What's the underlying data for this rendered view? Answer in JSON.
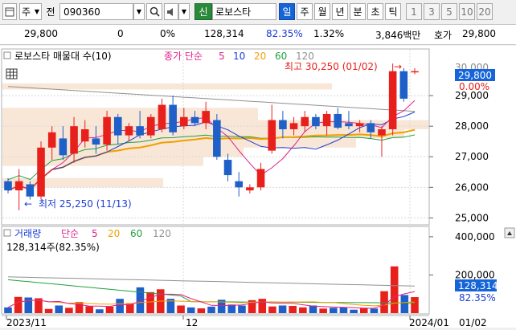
{
  "toolbar": {
    "market": "주",
    "market_prefix": "전",
    "code": "090360",
    "credit_tag": "신",
    "stock_name": "로보스타",
    "periods": [
      "일",
      "주",
      "월",
      "년",
      "분",
      "초",
      "틱"
    ],
    "active_period": "일",
    "intervals": [
      "1",
      "3",
      "5",
      "10",
      "20"
    ]
  },
  "infobar": {
    "price": "29,800",
    "change": "0",
    "change_pct": "0%",
    "volume": "128,314",
    "volume_ratio": "82.35%",
    "turnover": "1.32%",
    "amount": "3,846백만",
    "quote_label": "호가",
    "quote_price": "29,800"
  },
  "price_panel": {
    "title": "로보스타 매물대 수(10)",
    "ma_label": "종가 단순",
    "ma_periods": [
      "5",
      "10",
      "20",
      "60",
      "120"
    ],
    "high_label": "최고 30,250 (01/02)",
    "low_label": "최저 25,250 (11/13)",
    "price_tag": "29,800",
    "pct_tag": "0.00%",
    "y_ticks": [
      "29,000",
      "28,000",
      "27,000",
      "26,000",
      "25,000"
    ],
    "y_top_partial": "30,000"
  },
  "volume_panel": {
    "title": "거래량",
    "ma_label": "단순",
    "ma_periods": [
      "5",
      "20",
      "60",
      "120"
    ],
    "value_label": "128,314주(82.35%)",
    "vol_tag": "128,314",
    "vol_pct_tag": "82.35%",
    "y_ticks": [
      "400,000",
      "200,000"
    ]
  },
  "x_axis": {
    "labels": [
      "2023/11",
      "12",
      "2024/01",
      "01/02"
    ]
  },
  "colors": {
    "up": "#e8201c",
    "down": "#1e5fc8",
    "ma5": "#e0208c",
    "ma10": "#1a3dd6",
    "ma20": "#f0a000",
    "ma60": "#20a040",
    "ma120": "#909090",
    "profile": "#f5dcc4",
    "tag": "#1565d8"
  },
  "chart_data": {
    "type": "candlestick",
    "candles": [
      {
        "o": 26200,
        "h": 26300,
        "l": 25800,
        "c": 25900
      },
      {
        "o": 25900,
        "h": 26600,
        "l": 25250,
        "c": 26200
      },
      {
        "o": 26100,
        "h": 26200,
        "l": 25600,
        "c": 25700
      },
      {
        "o": 25700,
        "h": 27500,
        "l": 25600,
        "c": 27300
      },
      {
        "o": 27300,
        "h": 28000,
        "l": 26900,
        "c": 27800
      },
      {
        "o": 27600,
        "h": 28000,
        "l": 26900,
        "c": 27050
      },
      {
        "o": 27100,
        "h": 28300,
        "l": 26800,
        "c": 28000
      },
      {
        "o": 27500,
        "h": 28200,
        "l": 27300,
        "c": 27900
      },
      {
        "o": 27600,
        "h": 28000,
        "l": 27100,
        "c": 27400
      },
      {
        "o": 27400,
        "h": 28500,
        "l": 27200,
        "c": 28300
      },
      {
        "o": 28300,
        "h": 28400,
        "l": 27400,
        "c": 27700
      },
      {
        "o": 27700,
        "h": 28100,
        "l": 27500,
        "c": 28000
      },
      {
        "o": 28000,
        "h": 28500,
        "l": 27600,
        "c": 27700
      },
      {
        "o": 27700,
        "h": 28400,
        "l": 27600,
        "c": 28300
      },
      {
        "o": 27900,
        "h": 28900,
        "l": 27800,
        "c": 28700
      },
      {
        "o": 28700,
        "h": 29000,
        "l": 27700,
        "c": 27800
      },
      {
        "o": 28000,
        "h": 28600,
        "l": 27900,
        "c": 28300
      },
      {
        "o": 28300,
        "h": 28500,
        "l": 28000,
        "c": 28100
      },
      {
        "o": 28100,
        "h": 28800,
        "l": 27900,
        "c": 28500
      },
      {
        "o": 28200,
        "h": 28400,
        "l": 26900,
        "c": 27000
      },
      {
        "o": 26900,
        "h": 27100,
        "l": 26200,
        "c": 26400
      },
      {
        "o": 26200,
        "h": 26500,
        "l": 25700,
        "c": 26000
      },
      {
        "o": 25900,
        "h": 26100,
        "l": 25800,
        "c": 26000
      },
      {
        "o": 26000,
        "h": 26800,
        "l": 25900,
        "c": 26600
      },
      {
        "o": 27200,
        "h": 28700,
        "l": 27100,
        "c": 28200
      },
      {
        "o": 28200,
        "h": 28500,
        "l": 27600,
        "c": 27900
      },
      {
        "o": 27900,
        "h": 28300,
        "l": 27700,
        "c": 28100
      },
      {
        "o": 28000,
        "h": 28500,
        "l": 27800,
        "c": 28300
      },
      {
        "o": 28300,
        "h": 28400,
        "l": 27900,
        "c": 28000
      },
      {
        "o": 28000,
        "h": 28500,
        "l": 27700,
        "c": 28400
      },
      {
        "o": 28400,
        "h": 28600,
        "l": 27900,
        "c": 27950
      },
      {
        "o": 28100,
        "h": 28500,
        "l": 27900,
        "c": 28000
      },
      {
        "o": 28000,
        "h": 28200,
        "l": 27800,
        "c": 28100
      },
      {
        "o": 28100,
        "h": 28200,
        "l": 27600,
        "c": 27800
      },
      {
        "o": 27700,
        "h": 28000,
        "l": 27000,
        "c": 27900
      },
      {
        "o": 27900,
        "h": 30050,
        "l": 27700,
        "c": 29800
      },
      {
        "o": 29800,
        "h": 29900,
        "l": 28800,
        "c": 28900
      },
      {
        "o": 29800,
        "h": 29900,
        "l": 29700,
        "c": 29800
      }
    ],
    "volumes": [
      30,
      85,
      82,
      78,
      22,
      40,
      28,
      58,
      36,
      20,
      34,
      75,
      52,
      135,
      110,
      125,
      75,
      40,
      30,
      25,
      34,
      70,
      45,
      40,
      68,
      75,
      35,
      40,
      38,
      30,
      40,
      24,
      28,
      30,
      18,
      28,
      24,
      115,
      245,
      95,
      84
    ],
    "volume_axis": [
      0,
      450000
    ],
    "price_axis": [
      24800,
      30500
    ]
  }
}
